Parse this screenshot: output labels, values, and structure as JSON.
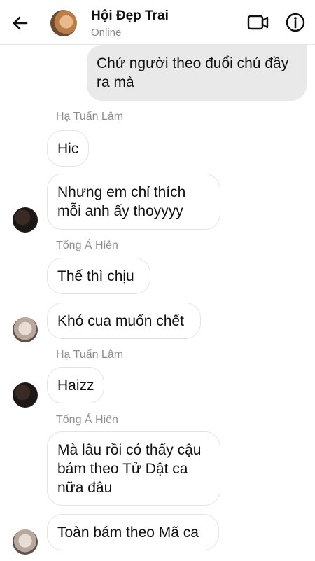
{
  "header": {
    "title": "Hội Đẹp Trai",
    "status": "Online",
    "back_icon": "arrow-left-icon",
    "video_icon": "video-camera-icon",
    "info_icon": "info-icon"
  },
  "colors": {
    "outgoing_bubble": "#e9e9e9",
    "incoming_bubble": "#ffffff",
    "sender_name": "#8e8e8e"
  },
  "messages": [
    {
      "direction": "out",
      "text": "Chứ người theo đuổi chú đầy ra mà"
    },
    {
      "direction": "in",
      "sender": "Hạ Tuấn Lâm",
      "text": "Hic"
    },
    {
      "direction": "in",
      "text": "Nhưng em chỉ thích mỗi anh ấy thoyyyy"
    },
    {
      "direction": "in",
      "sender": "Tống Á Hiên",
      "text": "Thế thì chịu"
    },
    {
      "direction": "in",
      "text": "Khó cua muốn chết"
    },
    {
      "direction": "in",
      "sender": "Hạ Tuấn Lâm",
      "text": "Haizz"
    },
    {
      "direction": "in",
      "sender": "Tống Á Hiên",
      "text": "Mà lâu rồi có thấy cậu bám theo Tử Dật ca nữa đâu"
    },
    {
      "direction": "in",
      "text": "Toàn bám theo Mã ca"
    }
  ]
}
